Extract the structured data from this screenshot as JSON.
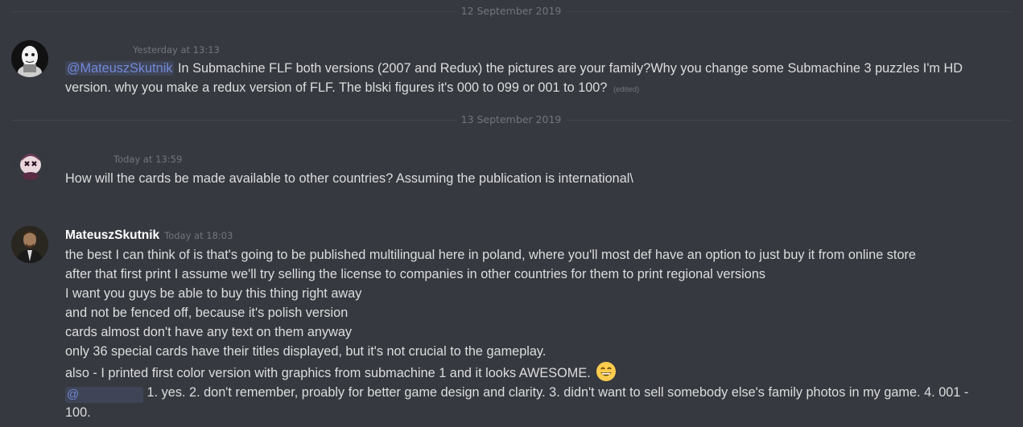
{
  "dividers": [
    "12 September 2019",
    "13 September 2019"
  ],
  "messages": [
    {
      "author": "",
      "timestamp": "Yesterday at 13:13",
      "mention": "@MateuszSkutnik",
      "line1": "In Submachine FLF both versions (2007 and Redux) the pictures are your family?Why you change some Submachine 3 puzzles I'm HD",
      "line2": "version.  why you make a redux version of FLF. The blski figures it's 000 to 099 or 001 to 100?",
      "edited": "(edited)"
    },
    {
      "author": "",
      "timestamp": "Today at 13:59",
      "line1": "How will the cards be made available to other countries? Assuming the publication is international\\"
    },
    {
      "author": "MateuszSkutnik",
      "timestamp": "Today at 18:03",
      "lines": [
        "the best I can think of is that's going to be published multilingual here in poland, where you'll most def have an option to just buy it from online store",
        "after that first print I assume we'll try selling the license to companies in other countries for them to print regional versions",
        "I want you guys be able to buy this thing right away",
        "and not be fenced off, because it's polish version",
        "cards almost don't have any text on them anyway",
        "only 36 special cards have their titles displayed, but it's not crucial to the gameplay.",
        "also - I printed first color version with graphics from submachine 1 and it looks AWESOME."
      ],
      "reply_mention": "@",
      "reply_line1": "1. yes. 2. don't remember, proably for better game design and clarity. 3. didn't want to sell somebody else's family photos in my game. 4. 001 -",
      "reply_line2": "100.",
      "emoji": "grinning-face-emoji"
    }
  ],
  "colors": {
    "background": "#36393f",
    "text": "#dcddde",
    "muted": "#72767d",
    "mention": "#7289da",
    "author": "#ffffff"
  }
}
